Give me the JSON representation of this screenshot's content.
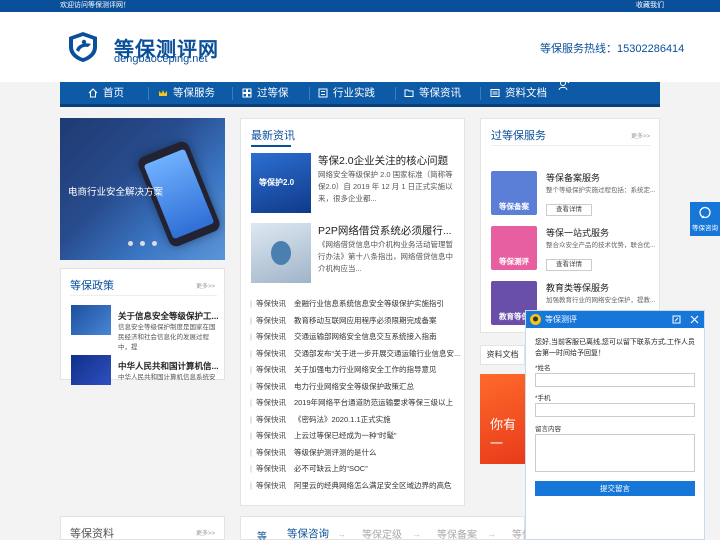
{
  "topbar": {
    "welcome": "欢迎访问等保测评网！",
    "right": "收藏我们"
  },
  "header": {
    "brand": "等保测评网",
    "domain": "dengbaoceping.net",
    "hotline": "等保服务热线：15302286414"
  },
  "nav": [
    {
      "label": "首页",
      "icon": "home-icon"
    },
    {
      "label": "等保服务",
      "icon": "crown-icon"
    },
    {
      "label": "过等保",
      "icon": "grid-icon"
    },
    {
      "label": "行业实践",
      "icon": "list-icon"
    },
    {
      "label": "等保资讯",
      "icon": "folder-icon"
    },
    {
      "label": "资料文档",
      "icon": "document-icon"
    }
  ],
  "banner": {
    "text": "电商行业安全解决方案"
  },
  "latest": {
    "title": "最新资讯",
    "items": [
      {
        "title": "等保2.0企业关注的核心问题",
        "thumb": "等保护2.0",
        "desc": "网络安全等级保护 2.0 国家标准（简称等保2.0）自 2019 年 12 月 1 日正式实施以来，很多企业都..."
      },
      {
        "title": "P2P网络借贷系统必须履行...",
        "desc": "《网络借贷信息中介机构业务活动管理暂行办法》第十八条指出，网络借贷信息中介机构应当..."
      }
    ],
    "list": [
      {
        "cat": "等保快讯",
        "text": "金融行业信息系统信息安全等级保护实施指引"
      },
      {
        "cat": "等保快讯",
        "text": "教育移动互联网应用程序必须限期完成备案"
      },
      {
        "cat": "等保快讯",
        "text": "交通运输部网络安全信息交互系统接入指南"
      },
      {
        "cat": "等保快讯",
        "text": "交通部发布“关于进一步开展交通运输行业信息安..."
      },
      {
        "cat": "等保快讯",
        "text": "关于加强电力行业网络安全工作的指导意见"
      },
      {
        "cat": "等保快讯",
        "text": "电力行业网络安全等级保护政策汇总"
      },
      {
        "cat": "等保快讯",
        "text": "2019年网络平台通道防范运输要求等保三级以上"
      },
      {
        "cat": "等保快讯",
        "text": "《密码法》2020.1.1正式实施"
      },
      {
        "cat": "等保快讯",
        "text": "上云过等保已经成为一种“时髦”"
      },
      {
        "cat": "等保快讯",
        "text": "等级保护测评测的是什么"
      },
      {
        "cat": "等保快讯",
        "text": "必不可缺云上的“SOC”"
      },
      {
        "cat": "等保快讯",
        "text": "阿里云的经典网络怎么满足安全区域边界的高危"
      }
    ]
  },
  "services": {
    "title": "过等保服务",
    "more": "更多>>",
    "items": [
      {
        "icon_label": "等保备案",
        "title": "等保备案服务",
        "desc": "整个等级保护实施过程包括：系统定...",
        "btn": "查看详情",
        "color": "#5b7fd6"
      },
      {
        "icon_label": "等保测评",
        "title": "等保一站式服务",
        "desc": "整合众安全产品的技术优势，联合优...",
        "btn": "查看详情",
        "color": "#e85fa1"
      },
      {
        "icon_label": "教育等保",
        "title": "教育类等保服务",
        "desc": "加强教育行业的网络安全保护，提教...",
        "btn": "查看详情",
        "color": "#6a4fa8"
      }
    ]
  },
  "policy": {
    "title": "等保政策",
    "more": "更多>>",
    "items": [
      {
        "title": "关于信息安全等级保护工...",
        "desc": "信息安全等级保护制度是国家在国民经济和社会信息化的发展过程中，提"
      },
      {
        "title": "中华人民共和国计算机信...",
        "desc": "中华人民共和国计算机信息系统安全保护 条例 (1994 年 2 月 18 日中华"
      }
    ]
  },
  "bottom": {
    "ziliao_title": "等保资料",
    "ziliao_more": "更多>>",
    "tabs": [
      "等",
      "等保咨询",
      "等保定级",
      "等保备案",
      "等保"
    ]
  },
  "docs_tab": "资料文档",
  "promo_text": "你有一",
  "side_tab": "等保咨询",
  "chat": {
    "title": "等保测评",
    "message": "您好,当前客服已离线,您可以留下联系方式,工作人员会第一时间给予回复！",
    "name_label": "*姓名",
    "phone_label": "*手机",
    "msg_label": "留言内容",
    "submit": "提交留言"
  },
  "colors": {
    "brand": "#0a4f9a",
    "nav": "#0d5aa7",
    "accent": "#1677d9"
  }
}
